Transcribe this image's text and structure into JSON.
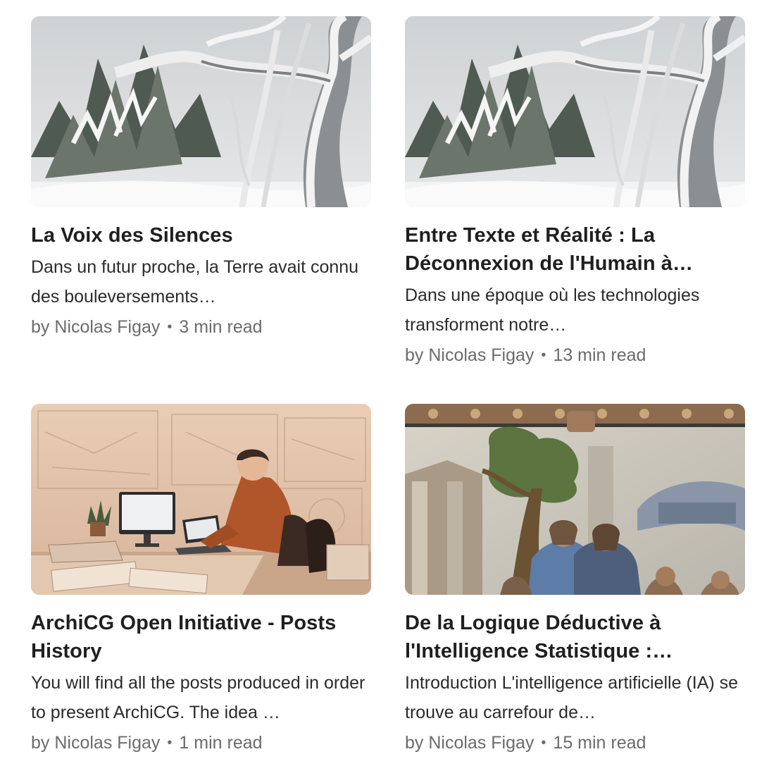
{
  "articles": [
    {
      "image": "snowy-trees-image",
      "title": "La Voix des Silences",
      "description": "Dans un futur proche, la Terre avait connu des bouleversements…",
      "author": "by Nicolas Figay",
      "separator": "•",
      "read_time": "3 min read"
    },
    {
      "image": "snowy-trees-image",
      "title": "Entre Texte et Réalité : La Déconnexion de l'Humain à…",
      "description": "Dans une époque où les technologies transforment notre…",
      "author": "by Nicolas Figay",
      "separator": "•",
      "read_time": "13 min read"
    },
    {
      "image": "architect-at-desk-image",
      "title": "ArchiCG Open Initiative - Posts History",
      "description": "You will find all the posts produced in order to present ArchiCG. The idea …",
      "author": "by Nicolas Figay",
      "separator": "•",
      "read_time": "1 min read"
    },
    {
      "image": "roman-mosaic-image",
      "title": "De la Logique Déductive à l'Intelligence Statistique :…",
      "description": "Introduction L'intelligence artificielle (IA) se trouve au carrefour de…",
      "author": "by Nicolas Figay",
      "separator": "•",
      "read_time": "15 min read"
    }
  ]
}
